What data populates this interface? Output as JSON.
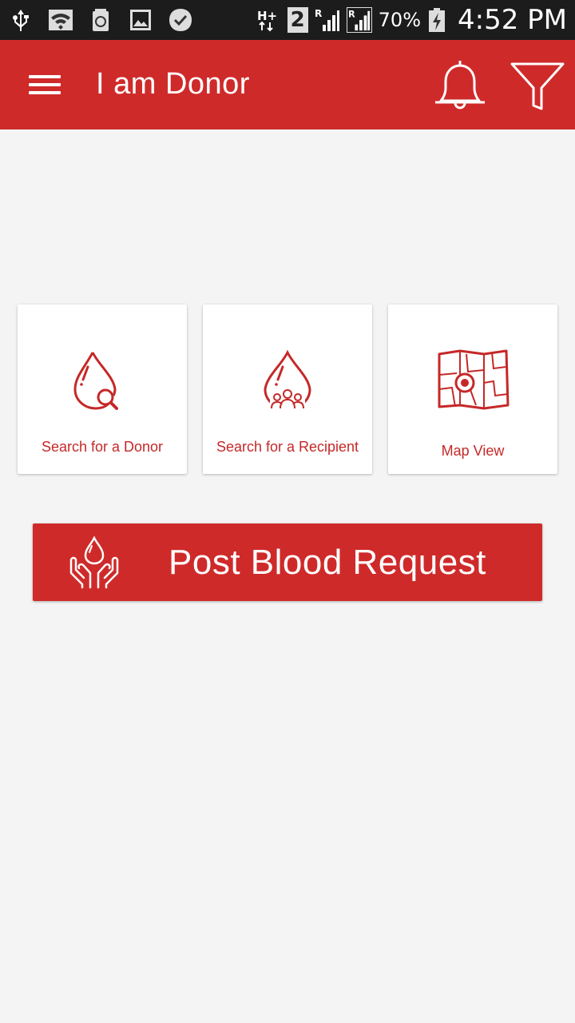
{
  "status_bar": {
    "sim_slot": "2",
    "battery_percent": "70%",
    "time": "4:52 PM",
    "icons": [
      "usb-icon",
      "wifi-icon",
      "recycle-icon",
      "gallery-icon",
      "check-bubble-icon",
      "h-plus-data-icon",
      "signal-roaming-icon",
      "signal-roaming-icon",
      "battery-charging-icon"
    ]
  },
  "app_bar": {
    "title": "I am Donor",
    "icons": [
      "menu-icon",
      "bell-icon",
      "filter-icon"
    ]
  },
  "cards": [
    {
      "label": "Search for a Donor",
      "icon": "blood-drop-search-icon"
    },
    {
      "label": "Search for a Recipient",
      "icon": "blood-drop-people-icon"
    },
    {
      "label": "Map View",
      "icon": "map-pin-icon"
    }
  ],
  "post_button": {
    "label": "Post Blood Request",
    "icon": "hands-blood-drop-icon"
  },
  "colors": {
    "primary": "#cf2a2a",
    "status_bar": "#1c1c1c",
    "background": "#f4f4f4",
    "card_text": "#c62828"
  }
}
